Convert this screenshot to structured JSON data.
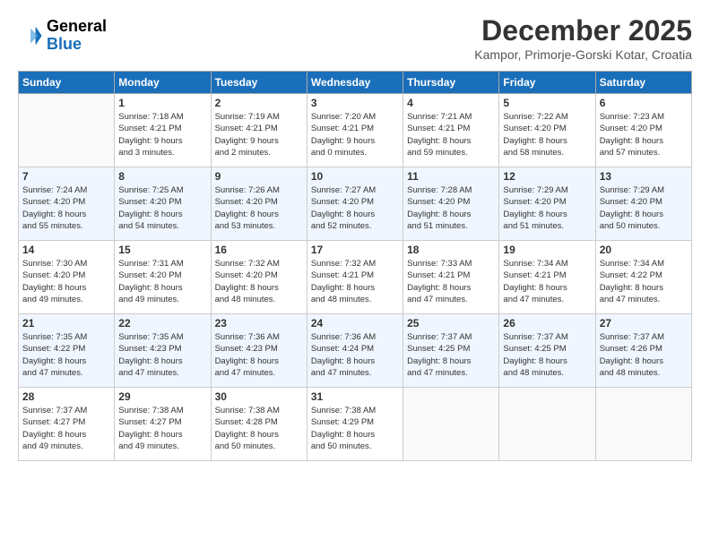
{
  "logo": {
    "general": "General",
    "blue": "Blue"
  },
  "header": {
    "month": "December 2025",
    "location": "Kampor, Primorje-Gorski Kotar, Croatia"
  },
  "days": [
    "Sunday",
    "Monday",
    "Tuesday",
    "Wednesday",
    "Thursday",
    "Friday",
    "Saturday"
  ],
  "weeks": [
    [
      {
        "day": "",
        "info": ""
      },
      {
        "day": "1",
        "info": "Sunrise: 7:18 AM\nSunset: 4:21 PM\nDaylight: 9 hours\nand 3 minutes."
      },
      {
        "day": "2",
        "info": "Sunrise: 7:19 AM\nSunset: 4:21 PM\nDaylight: 9 hours\nand 2 minutes."
      },
      {
        "day": "3",
        "info": "Sunrise: 7:20 AM\nSunset: 4:21 PM\nDaylight: 9 hours\nand 0 minutes."
      },
      {
        "day": "4",
        "info": "Sunrise: 7:21 AM\nSunset: 4:21 PM\nDaylight: 8 hours\nand 59 minutes."
      },
      {
        "day": "5",
        "info": "Sunrise: 7:22 AM\nSunset: 4:20 PM\nDaylight: 8 hours\nand 58 minutes."
      },
      {
        "day": "6",
        "info": "Sunrise: 7:23 AM\nSunset: 4:20 PM\nDaylight: 8 hours\nand 57 minutes."
      }
    ],
    [
      {
        "day": "7",
        "info": "Sunrise: 7:24 AM\nSunset: 4:20 PM\nDaylight: 8 hours\nand 55 minutes."
      },
      {
        "day": "8",
        "info": "Sunrise: 7:25 AM\nSunset: 4:20 PM\nDaylight: 8 hours\nand 54 minutes."
      },
      {
        "day": "9",
        "info": "Sunrise: 7:26 AM\nSunset: 4:20 PM\nDaylight: 8 hours\nand 53 minutes."
      },
      {
        "day": "10",
        "info": "Sunrise: 7:27 AM\nSunset: 4:20 PM\nDaylight: 8 hours\nand 52 minutes."
      },
      {
        "day": "11",
        "info": "Sunrise: 7:28 AM\nSunset: 4:20 PM\nDaylight: 8 hours\nand 51 minutes."
      },
      {
        "day": "12",
        "info": "Sunrise: 7:29 AM\nSunset: 4:20 PM\nDaylight: 8 hours\nand 51 minutes."
      },
      {
        "day": "13",
        "info": "Sunrise: 7:29 AM\nSunset: 4:20 PM\nDaylight: 8 hours\nand 50 minutes."
      }
    ],
    [
      {
        "day": "14",
        "info": "Sunrise: 7:30 AM\nSunset: 4:20 PM\nDaylight: 8 hours\nand 49 minutes."
      },
      {
        "day": "15",
        "info": "Sunrise: 7:31 AM\nSunset: 4:20 PM\nDaylight: 8 hours\nand 49 minutes."
      },
      {
        "day": "16",
        "info": "Sunrise: 7:32 AM\nSunset: 4:20 PM\nDaylight: 8 hours\nand 48 minutes."
      },
      {
        "day": "17",
        "info": "Sunrise: 7:32 AM\nSunset: 4:21 PM\nDaylight: 8 hours\nand 48 minutes."
      },
      {
        "day": "18",
        "info": "Sunrise: 7:33 AM\nSunset: 4:21 PM\nDaylight: 8 hours\nand 47 minutes."
      },
      {
        "day": "19",
        "info": "Sunrise: 7:34 AM\nSunset: 4:21 PM\nDaylight: 8 hours\nand 47 minutes."
      },
      {
        "day": "20",
        "info": "Sunrise: 7:34 AM\nSunset: 4:22 PM\nDaylight: 8 hours\nand 47 minutes."
      }
    ],
    [
      {
        "day": "21",
        "info": "Sunrise: 7:35 AM\nSunset: 4:22 PM\nDaylight: 8 hours\nand 47 minutes."
      },
      {
        "day": "22",
        "info": "Sunrise: 7:35 AM\nSunset: 4:23 PM\nDaylight: 8 hours\nand 47 minutes."
      },
      {
        "day": "23",
        "info": "Sunrise: 7:36 AM\nSunset: 4:23 PM\nDaylight: 8 hours\nand 47 minutes."
      },
      {
        "day": "24",
        "info": "Sunrise: 7:36 AM\nSunset: 4:24 PM\nDaylight: 8 hours\nand 47 minutes."
      },
      {
        "day": "25",
        "info": "Sunrise: 7:37 AM\nSunset: 4:25 PM\nDaylight: 8 hours\nand 47 minutes."
      },
      {
        "day": "26",
        "info": "Sunrise: 7:37 AM\nSunset: 4:25 PM\nDaylight: 8 hours\nand 48 minutes."
      },
      {
        "day": "27",
        "info": "Sunrise: 7:37 AM\nSunset: 4:26 PM\nDaylight: 8 hours\nand 48 minutes."
      }
    ],
    [
      {
        "day": "28",
        "info": "Sunrise: 7:37 AM\nSunset: 4:27 PM\nDaylight: 8 hours\nand 49 minutes."
      },
      {
        "day": "29",
        "info": "Sunrise: 7:38 AM\nSunset: 4:27 PM\nDaylight: 8 hours\nand 49 minutes."
      },
      {
        "day": "30",
        "info": "Sunrise: 7:38 AM\nSunset: 4:28 PM\nDaylight: 8 hours\nand 50 minutes."
      },
      {
        "day": "31",
        "info": "Sunrise: 7:38 AM\nSunset: 4:29 PM\nDaylight: 8 hours\nand 50 minutes."
      },
      {
        "day": "",
        "info": ""
      },
      {
        "day": "",
        "info": ""
      },
      {
        "day": "",
        "info": ""
      }
    ]
  ]
}
